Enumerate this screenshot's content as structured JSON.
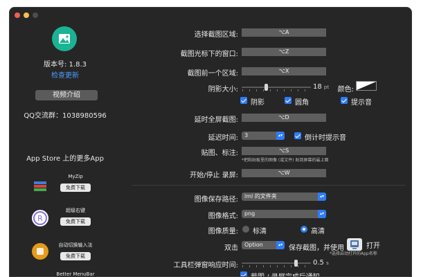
{
  "sidebar": {
    "version": "版本号: 1.8.3",
    "check_update": "检查更新",
    "intro_button": "视频介绍",
    "qq_group": "QQ交流群：1038980596",
    "more_apps": "App Store 上的更多App",
    "download_label": "免费下载",
    "apps": [
      {
        "name": "MyZip"
      },
      {
        "name": "超级右键"
      },
      {
        "name": "自动切换输入法"
      },
      {
        "name": "Better MenuBar"
      }
    ]
  },
  "settings": {
    "region_label": "选择截图区域:",
    "region_key": "⌥A",
    "under_cursor_label": "截图光标下的窗口:",
    "under_cursor_key": "⌥Z",
    "previous_region_label": "截图前一个区域:",
    "previous_region_key": "⌥X",
    "shadow_label": "阴影大小:",
    "shadow_value": "18",
    "shadow_unit": "pt",
    "shadow_fraction": 0.35,
    "color_label": "颜色:",
    "opt_shadow": "阴影",
    "opt_round": "圆角",
    "opt_sound": "提示音",
    "delay_full_label": "延时全屏截图:",
    "delay_full_key": "⌥D",
    "delay_time_label": "延迟时间:",
    "delay_time_value": "3",
    "countdown_sound": "倒计时提示音",
    "paste_label": "贴图、标注:",
    "paste_key": "⌥S",
    "paste_hint": "*把粘贴板里的图像 (或文件) 贴到屏幕的最上面",
    "record_label": "开始/停止 录屏:",
    "record_key": "⌥W",
    "save_path_label": "图像保存路径:",
    "save_path_value": "lml 的文件夹",
    "format_label": "图像格式:",
    "format_value": "png",
    "quality_label": "图像质量:",
    "quality_standard": "标清",
    "quality_high": "高清",
    "double_click_label": "双击",
    "double_click_key": "Option",
    "save_and_use": "保存截图，并使用",
    "open_label": "打开",
    "open_hint": "*选择启动打开的App名称",
    "toolbar_delay_label": "工具栏弹窗响应时间:",
    "toolbar_delay_value": "0.5",
    "toolbar_delay_unit": "s",
    "toolbar_delay_fraction": 0.8,
    "notify_label": "截图 / 录屏完成后通知"
  },
  "colors": {
    "accent": "#2f7cf6",
    "link": "#4a9eff",
    "logo": "#1ab394",
    "window": "#262626"
  }
}
